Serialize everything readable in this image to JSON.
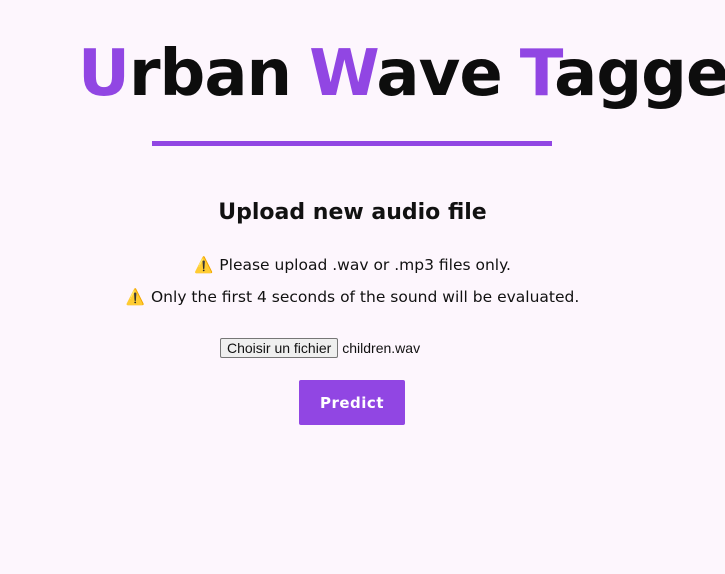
{
  "header": {
    "title_parts": {
      "w1_initial": "U",
      "w1_rest": "rban",
      "w2_initial": "W",
      "w2_rest": "ave",
      "w3_initial": "T",
      "w3_rest": "agger"
    }
  },
  "upload": {
    "heading": "Upload new audio file",
    "notes": [
      {
        "icon": "⚠️",
        "text": "Please upload .wav or .mp3 files only."
      },
      {
        "icon": "⚠️",
        "text": "Only the first 4 seconds of the sound will be evaluated."
      }
    ],
    "file_button_label": "Choisir un fichier",
    "file_name": "children.wav",
    "predict_label": "Predict"
  },
  "colors": {
    "accent": "#9146e3",
    "background": "#fdf6fd",
    "text": "#111111"
  }
}
